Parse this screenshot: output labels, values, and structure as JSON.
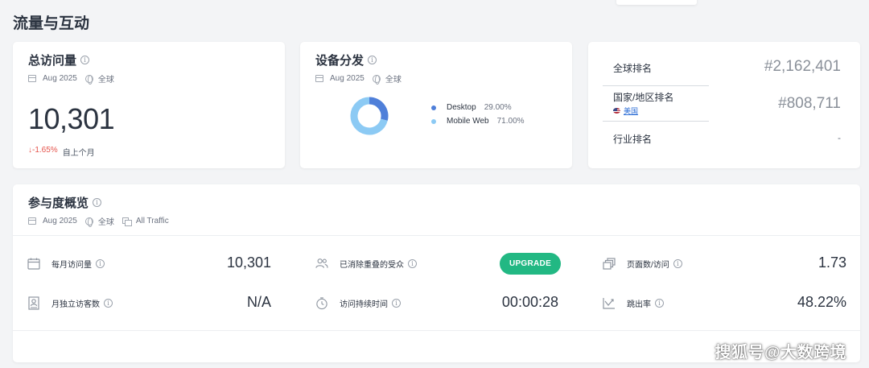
{
  "page": {
    "title": "流量与互动"
  },
  "total_visits": {
    "title": "总访问量",
    "date": "Aug 2025",
    "region": "全球",
    "value": "10,301",
    "change": "↓-1.65%",
    "change_label": "自上个月"
  },
  "device_distribution": {
    "title": "设备分发",
    "date": "Aug 2025",
    "region": "全球",
    "legend": [
      {
        "name": "Desktop",
        "pct": "29.00%",
        "color": "#4f7fd9"
      },
      {
        "name": "Mobile Web",
        "pct": "71.00%",
        "color": "#8ccaf4"
      }
    ]
  },
  "chart_data": {
    "type": "pie",
    "categories": [
      "Desktop",
      "Mobile Web"
    ],
    "values": [
      29.0,
      71.0
    ],
    "colors": [
      "#4f7fd9",
      "#8ccaf4"
    ],
    "title": "",
    "legend": "right"
  },
  "ranking": {
    "global_label": "全球排名",
    "global_value": "#2,162,401",
    "country_label": "国家/地区排名",
    "country_name": "美国",
    "country_value": "#808,711",
    "industry_label": "行业排名",
    "industry_value": "-"
  },
  "engagement": {
    "title": "参与度概览",
    "date": "Aug 2025",
    "region": "全球",
    "traffic": "All Traffic",
    "metrics": [
      {
        "label": "每月访问量",
        "value": "10,301",
        "icon": "calendar-icon"
      },
      {
        "label": "已消除重叠的受众",
        "value": "UPGRADE",
        "icon": "users-icon"
      },
      {
        "label": "页面数/访问",
        "value": "1.73",
        "icon": "pages-icon"
      },
      {
        "label": "月独立访客数",
        "value": "N/A",
        "icon": "visitor-card-icon"
      },
      {
        "label": "访问持续时间",
        "value": "00:00:28",
        "icon": "clock-icon"
      },
      {
        "label": "跳出率",
        "value": "48.22%",
        "icon": "bounce-icon"
      }
    ]
  },
  "watermark": "搜狐号@大数跨境"
}
